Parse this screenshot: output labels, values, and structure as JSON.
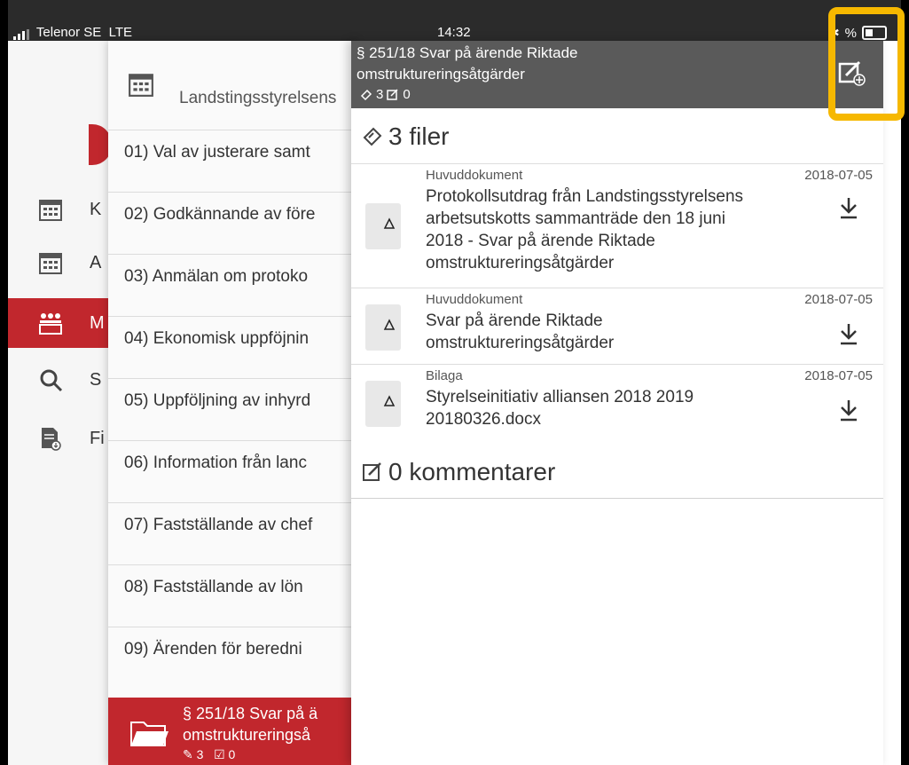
{
  "status_bar": {
    "carrier": "Telenor SE",
    "network": "LTE",
    "time": "14:32",
    "battery_text": "%"
  },
  "menu": {
    "items": [
      {
        "label": "K",
        "icon": "calendar-icon"
      },
      {
        "label": "A",
        "icon": "calendar-icon"
      },
      {
        "label": "M",
        "icon": "group-icon",
        "active": true
      },
      {
        "label": "S",
        "icon": "search-icon"
      },
      {
        "label": "Fi",
        "icon": "file-download-icon"
      }
    ]
  },
  "agenda": {
    "title": "Landstingsstyrelsens",
    "items": [
      "01) Val av justerare samt",
      "02) Godkännande av före",
      "03) Anmälan om protoko",
      "04) Ekonomisk uppföjnin",
      "05) Uppföljning av inhyrd",
      "06) Information från lanc",
      "07) Fastställande av chef",
      "08) Fastställande av lön",
      "09) Ärenden för beredni"
    ],
    "selected": {
      "line1": "§ 251/18 Svar på ä",
      "line2": "omstruktureringså",
      "files": "3",
      "comments": "0"
    }
  },
  "detail": {
    "title_line1": "§ 251/18 Svar på ärende Riktade",
    "title_line2": "omstruktureringsåtgärder",
    "files_count": "3",
    "comments_count": "0",
    "files_heading": "3 filer",
    "files": [
      {
        "type": "Huvuddokument",
        "date": "2018-07-05",
        "name_lines": [
          "Protokollsutdrag från Landstingsstyrelsens",
          "arbetsutskotts sammanträde den 18 juni",
          "2018 - Svar på ärende Riktade",
          "omstruktureringsåtgärder"
        ]
      },
      {
        "type": "Huvuddokument",
        "date": "2018-07-05",
        "name_lines": [
          "Svar på ärende Riktade",
          "omstruktureringsåtgärder"
        ]
      },
      {
        "type": "Bilaga",
        "date": "2018-07-05",
        "name_lines": [
          "Styrelseinitiativ alliansen 2018 2019",
          "20180326.docx"
        ]
      }
    ],
    "comments_heading": "0 kommentarer"
  },
  "colors": {
    "accent_red": "#c1272d",
    "header_gray": "#5a5a5a",
    "highlight_yellow": "#f6b800"
  }
}
